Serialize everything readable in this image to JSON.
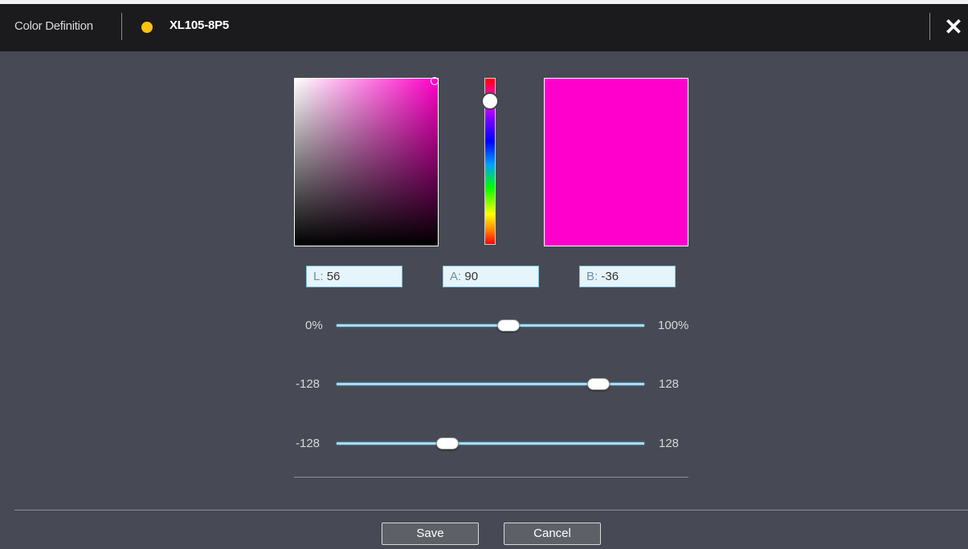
{
  "titlebar": {
    "title": "Color Definition",
    "color_dot": "#ffc20e",
    "color_name": "XL105-8P5",
    "close_glyph": "✕"
  },
  "picker": {
    "preview_color": "#ff00cc"
  },
  "fields": {
    "L": {
      "prefix": "L:",
      "value": "56"
    },
    "A": {
      "prefix": "A:",
      "value": "90"
    },
    "B": {
      "prefix": "B:",
      "value": "-36"
    }
  },
  "sliders": [
    {
      "min_label": "0%",
      "max_label": "100%",
      "fraction": 0.56
    },
    {
      "min_label": "-128",
      "max_label": "128",
      "fraction": 0.85
    },
    {
      "min_label": "-128",
      "max_label": "128",
      "fraction": 0.36
    }
  ],
  "buttons": {
    "save": "Save",
    "cancel": "Cancel"
  }
}
